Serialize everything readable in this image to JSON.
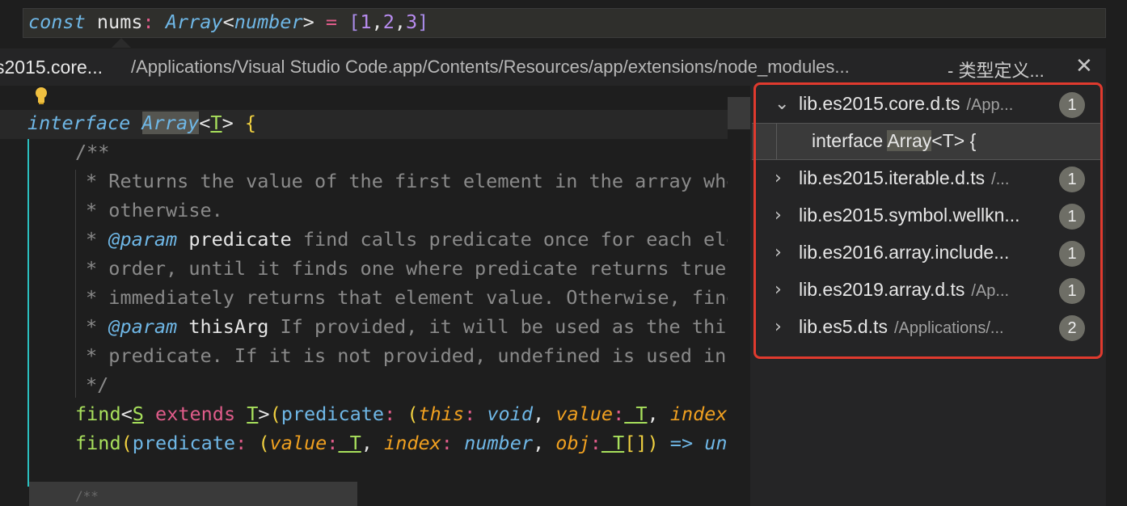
{
  "top_code": {
    "const_kw": "const",
    "var": "nums",
    "colon": ":",
    "type": "Array",
    "lt": "<",
    "generic": "number",
    "gt": ">",
    "eq": "=",
    "open": "[",
    "n1": "1",
    "c1": ",",
    "n2": "2",
    "c2": ",",
    "n3": "3",
    "close": "]"
  },
  "peek_header": {
    "filename": "s2015.core...",
    "path": "/Applications/Visual Studio Code.app/Contents/Resources/app/extensions/node_modules...",
    "kind": "- 类型定义...",
    "close_symbol": "✕"
  },
  "editor": {
    "l1": {
      "kw": "interface",
      "name": "Array",
      "lt": "<",
      "tp": "T",
      "gt": ">",
      "brace": "{"
    },
    "l2": "/**",
    "l3": "* Returns the value of the first element in the array whe",
    "l4": "* otherwise.",
    "l5": {
      "star": "* ",
      "tag": "@param",
      "name": " predicate",
      "rest": " find calls predicate once for each ele"
    },
    "l6": "* order, until it finds one where predicate returns true.",
    "l7": "* immediately returns that element value. Otherwise, find",
    "l8": {
      "star": "* ",
      "tag": "@param",
      "name": " thisArg",
      "rest": " If provided, it will be used as the this"
    },
    "l9": "* predicate. If it is not provided, undefined is used ins",
    "l10": "*/",
    "l11": {
      "fn": "find",
      "lt": "<",
      "s": "S",
      "ext": " extends ",
      "t": "T",
      "gt": ">",
      "open": "(",
      "p": "predicate",
      "colon": ":",
      "open2": " (",
      "this": "this",
      "c2": ":",
      "void": " void",
      "comma": ",",
      "value": " value",
      "c3": ":",
      "t2": " T",
      "comma2": ",",
      "index": " index",
      "c4": ":"
    },
    "l12": {
      "fn": "find",
      "open": "(",
      "p": "predicate",
      "colon": ":",
      "open2": " (",
      "value": "value",
      "c1": ":",
      "t": " T",
      "comma": ",",
      "index": " index",
      "c2": ":",
      "number": " number",
      "comma2": ",",
      "obj": " obj",
      "c3": ":",
      "t2": " T",
      "arr": "[])",
      "arrow": " =>",
      "unk": " unk"
    },
    "l13": "/**"
  },
  "references": {
    "groups": [
      {
        "chevron": "⌄",
        "file": "lib.es2015.core.d.ts",
        "path": "/App...",
        "count": "1"
      },
      {
        "chevron": "›",
        "file": "lib.es2015.iterable.d.ts",
        "path": "/...",
        "count": "1"
      },
      {
        "chevron": "›",
        "file": "lib.es2015.symbol.wellkn...",
        "path": "",
        "count": "1"
      },
      {
        "chevron": "›",
        "file": "lib.es2016.array.include...",
        "path": "",
        "count": "1"
      },
      {
        "chevron": "›",
        "file": "lib.es2019.array.d.ts",
        "path": "/Ap...",
        "count": "1"
      },
      {
        "chevron": "›",
        "file": "lib.es5.d.ts",
        "path": "/Applications/...",
        "count": "2"
      }
    ],
    "selected_item": {
      "pre": "interface ",
      "match": "Array",
      "post": "<T> {"
    }
  },
  "colors": {
    "highlight_border": "#e03a2e",
    "indent_guide": "#2bbfbf",
    "badge": "#6e6e66"
  }
}
